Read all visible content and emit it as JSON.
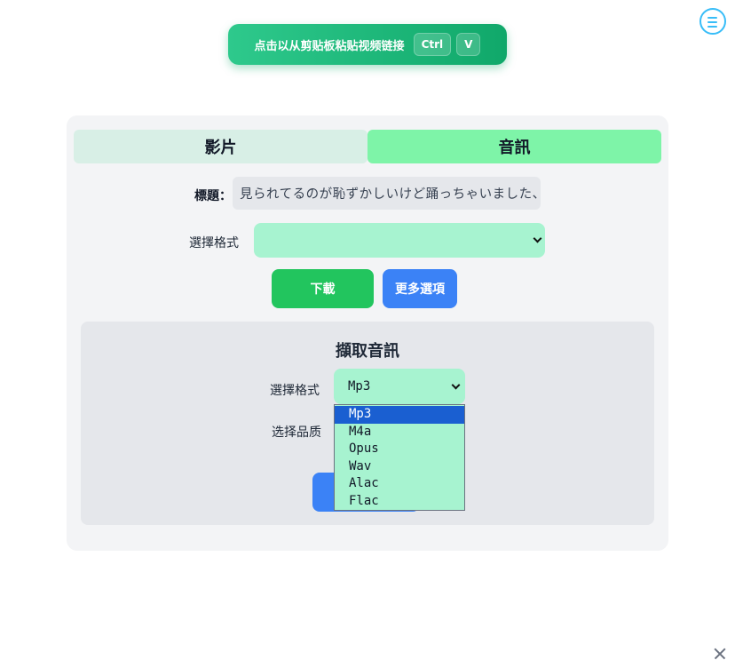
{
  "paste_button": {
    "label": "点击以从剪贴板粘贴视频链接",
    "key1": "Ctrl",
    "key2": "V"
  },
  "menu": {
    "icon": "hamburger-menu-icon"
  },
  "tabs": [
    {
      "label": "影片",
      "active": false
    },
    {
      "label": "音訊",
      "active": true
    }
  ],
  "title": {
    "label": "標題：",
    "value": "見られてるのが恥ずかしいけど踊っちゃいました、"
  },
  "format_select": {
    "label": "選擇格式",
    "value": ""
  },
  "actions": {
    "download_label": "下載",
    "more_label": "更多選項"
  },
  "extract_panel": {
    "title": "擷取音訊",
    "format_label": "選擇格式",
    "format_value": "Mp3",
    "quality_label": "选择品质",
    "format_options": [
      "Mp3",
      "M4a",
      "Opus",
      "Wav",
      "Alac",
      "Flac"
    ],
    "selected_option": "Mp3"
  },
  "close": {
    "icon": "close-icon"
  },
  "colors": {
    "accent_green": "#22c55e",
    "accent_blue": "#3b82f6",
    "select_bg": "#a7f3d0",
    "active_tab": "#7ef4a8",
    "menu_icon": "#38bdf8"
  }
}
